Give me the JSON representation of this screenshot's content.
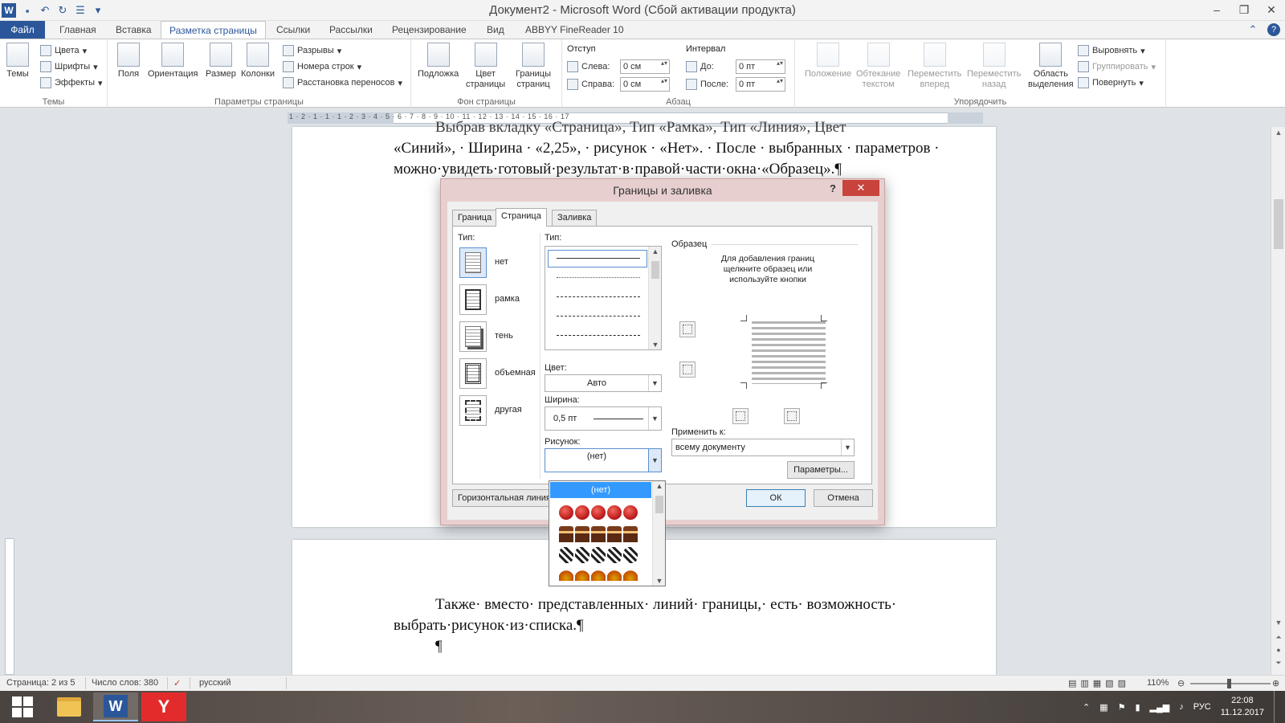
{
  "window": {
    "title": "Документ2 - Microsoft Word (Сбой активации продукта)",
    "app_icon": "W"
  },
  "ribbon_tabs": [
    {
      "label": "Файл"
    },
    {
      "label": "Главная"
    },
    {
      "label": "Вставка"
    },
    {
      "label": "Разметка страницы"
    },
    {
      "label": "Ссылки"
    },
    {
      "label": "Рассылки"
    },
    {
      "label": "Рецензирование"
    },
    {
      "label": "Вид"
    },
    {
      "label": "ABBYY FineReader 10"
    }
  ],
  "ribbon": {
    "themes": {
      "label": "Темы",
      "btn": "Темы",
      "colors": "Цвета",
      "fonts": "Шрифты",
      "effects": "Эффекты"
    },
    "page_setup": {
      "label": "Параметры страницы",
      "margins": "Поля",
      "orientation": "Ориентация",
      "size": "Размер",
      "columns": "Колонки",
      "breaks": "Разрывы",
      "line_numbers": "Номера строк",
      "hyphenation": "Расстановка переносов"
    },
    "page_background": {
      "label": "Фон страницы",
      "watermark": "Подложка",
      "page_color_1": "Цвет",
      "page_color_2": "страницы",
      "page_borders_1": "Границы",
      "page_borders_2": "страниц"
    },
    "paragraph": {
      "label": "Абзац",
      "indent": "Отступ",
      "spacing": "Интервал",
      "left": "Слева:",
      "right": "Справа:",
      "before": "До:",
      "after": "После:",
      "left_val": "0 см",
      "right_val": "0 см",
      "before_val": "0 пт",
      "after_val": "0 пт"
    },
    "arrange": {
      "label": "Упорядочить",
      "position": "Положение",
      "wrap_1": "Обтекание",
      "wrap_2": "текстом",
      "forward_1": "Переместить",
      "forward_2": "вперед",
      "backward_1": "Переместить",
      "backward_2": "назад",
      "selection_1": "Область",
      "selection_2": "выделения",
      "align": "Выровнять",
      "group": "Группировать",
      "rotate": "Повернуть"
    }
  },
  "ruler": {
    "numbers": "1 · 2 · 1 · 1 · 1 · 2 · 3 · 4 · 5 · 6 · 7 · 8 · 9 · 10 · 11 · 12 · 13 · 14 · 15 · 16 · 17"
  },
  "document": {
    "p1_line0": "Выбрав вкладку «Страница», Тип «Рамка», Тип «Линия», Цвет",
    "p1_line1": "«Синий», · Ширина · «2,25», · рисунок · «Нет». · После · выбранных · параметров ·",
    "p1_line2": "можно·увидеть·готовый·результат·в·правой·части·окна·«Образец».¶",
    "p2_line1": "Также· вместо· представленных· линий· границы,· есть· возможность·",
    "p2_line2": "выбрать·рисунок·из·списка.¶",
    "p2_line3": "¶"
  },
  "dialog": {
    "title": "Границы и заливка",
    "help": "?",
    "close": "✕",
    "tabs": [
      "Граница",
      "Страница",
      "Заливка"
    ],
    "setting_label": "Тип:",
    "settings": [
      "нет",
      "рамка",
      "тень",
      "объемная",
      "другая"
    ],
    "style_label": "Тип:",
    "color_label": "Цвет:",
    "color_value": "Авто",
    "width_label": "Ширина:",
    "width_value": "0,5 пт",
    "art_label": "Рисунок:",
    "art_value": "(нет)",
    "preview_label": "Образец",
    "preview_hint": "Для добавления границ щелкните образец или используйте кнопки",
    "apply_label": "Применить к:",
    "apply_value": "всему документу",
    "options_btn": "Параметры...",
    "hline_btn": "Горизонтальная линия...",
    "ok_btn": "ОК",
    "cancel_btn": "Отмена",
    "art_list_selected": "(нет)"
  },
  "status": {
    "page": "Страница: 2 из 5",
    "words": "Число слов: 380",
    "language": "русский",
    "zoom": "110%"
  },
  "taskbar": {
    "lang": "РУС",
    "time": "22:08",
    "date": "11.12.2017"
  }
}
